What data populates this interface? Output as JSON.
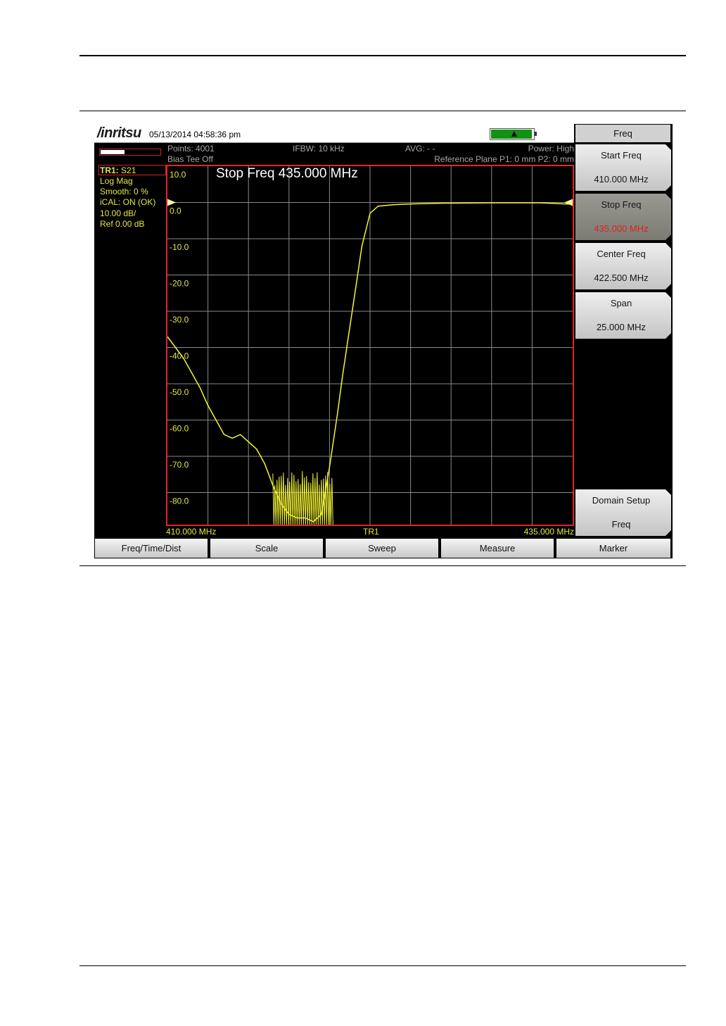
{
  "header": {
    "brand": "/inritsu",
    "datetime": "05/13/2014 04:58:36 pm"
  },
  "info": {
    "points": "Points: 4001",
    "ifbw": "IFBW: 10 kHz",
    "avg": "AVG: - -",
    "power": "Power: High",
    "bias_tee": "Bias Tee Off",
    "ref_plane": "Reference Plane P1: 0 mm P2: 0 mm"
  },
  "trace": {
    "tr_label": "TR1:",
    "tr_param": "S21",
    "format": "Log Mag",
    "smooth": "Smooth: 0 %",
    "ical": "iCAL: ON (OK)",
    "scale": "10.00 dB/",
    "ref": "Ref 0.00 dB"
  },
  "plot": {
    "overlay": "Stop Freq 435.000 MHz",
    "start_label": "410.000 MHz",
    "center_label": "TR1",
    "stop_label": "435.000 MHz",
    "y_ticks": [
      "10.0",
      "0.0",
      "-10.0",
      "-20.0",
      "-30.0",
      "-40.0",
      "-50.0",
      "-60.0",
      "-70.0",
      "-80.0"
    ]
  },
  "chart_data": {
    "type": "line",
    "xlabel": "",
    "ylabel": "",
    "xlim": [
      410.0,
      435.0
    ],
    "ylim": [
      -90,
      10
    ],
    "grid": true,
    "series": [
      {
        "color": "#f5f532",
        "x": [
          410.0,
          410.5,
          411.0,
          411.5,
          412.0,
          412.5,
          413.0,
          413.5,
          414.0,
          414.5,
          415.0,
          415.5,
          416.0,
          416.5,
          417.0,
          417.5,
          418.0,
          418.5,
          419.0,
          419.5,
          420.0,
          420.5,
          420.8,
          421.2,
          421.6,
          422.0,
          422.5,
          423.0,
          424.0,
          425.0,
          427.0,
          430.0,
          433.0,
          434.0,
          435.0
        ],
        "y": [
          -37,
          -40,
          -43,
          -47,
          -51,
          -56,
          -60,
          -64,
          -65,
          -64,
          -66,
          -68,
          -72,
          -78,
          -83,
          -86,
          -87,
          -87,
          -88,
          -86,
          -73,
          -58,
          -48,
          -36,
          -24,
          -12,
          -3,
          -1,
          -0.6,
          -0.4,
          -0.2,
          -0.1,
          -0.1,
          -0.3,
          -0.5
        ]
      }
    ]
  },
  "softkeys": {
    "header": "Freq",
    "keys": [
      {
        "label": "Start Freq",
        "value": "410.000 MHz"
      },
      {
        "label": "Stop Freq",
        "value": "435.000 MHz"
      },
      {
        "label": "Center Freq",
        "value": "422.500 MHz"
      },
      {
        "label": "Span",
        "value": "25.000 MHz"
      }
    ],
    "bottom": {
      "label": "Domain Setup",
      "value": "Freq"
    }
  },
  "menu": [
    "Freq/Time/Dist",
    "Scale",
    "Sweep",
    "Measure",
    "Marker"
  ],
  "colors": {
    "trace": "#f5f532",
    "plot_border": "#e1262b",
    "active_value": "#e02020",
    "battery": "#129212"
  }
}
